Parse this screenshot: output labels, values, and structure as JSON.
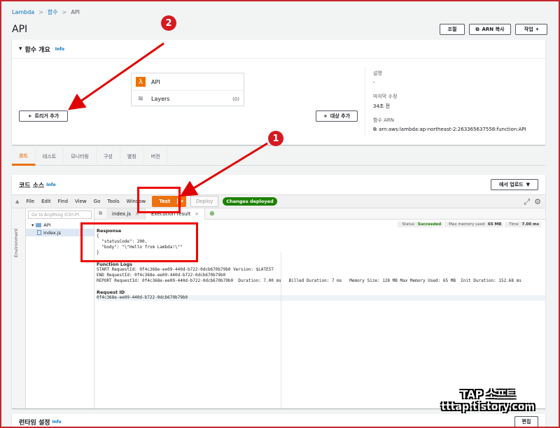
{
  "breadcrumb": {
    "root": "Lambda",
    "level2": "함수",
    "current": "API"
  },
  "title": "API",
  "header_buttons": {
    "throttle": "조절",
    "copy_arn": "ARN 복사",
    "actions": "작업"
  },
  "overview": {
    "heading": "함수 개요",
    "info": "Info",
    "function_name": "API",
    "layers_label": "Layers",
    "layers_count": "(0)",
    "add_trigger": "트리거 추가",
    "add_destination": "대상 추가",
    "description_label": "설명",
    "description_value": "-",
    "last_modified_label": "마지막 수정",
    "last_modified_value": "34초 전",
    "arn_label": "함수 ARN",
    "arn_value": "arn:aws:lambda:ap-northeast-2:263365637558:function:API"
  },
  "tabs": [
    "코드",
    "테스트",
    "모니터링",
    "구성",
    "별칭",
    "버전"
  ],
  "code_source": {
    "heading": "코드 소스",
    "info": "Info",
    "upload": "에서 업로드",
    "menu": [
      "File",
      "Edit",
      "Find",
      "View",
      "Go",
      "Tools",
      "Window"
    ],
    "test": "Test",
    "deploy": "Deploy",
    "deployed": "Changes deployed",
    "goto_placeholder": "Go to Anything (Ctrl-P)",
    "env_label": "Environment",
    "folder": "API",
    "file": "index.js",
    "tab_file": "index.js",
    "tab_result": "Execution result",
    "status_label": "Status",
    "status_value": "Succeeded",
    "memory_label": "Max memory used",
    "memory_value": "65 MB",
    "time_label": "Time",
    "time_value": "7.00 ms"
  },
  "result": {
    "response_heading": "Response",
    "response_lines": [
      "{",
      "  \"statusCode\": 200,",
      "  \"body\": \"\\\"Hello from Lambda!\\\"\"",
      "}"
    ],
    "logs_heading": "Function Logs",
    "log_lines": [
      "START RequestId: 0f4c368e-ee09-440d-b722-0dcb670b79b0 Version: $LATEST",
      "END RequestId: 0f4c368e-ee09-440d-b722-0dcb670b79b0",
      "REPORT RequestId: 0f4c368e-ee09-440d-b722-0dcb670b79b0  Duration: 7.00 ms   Billed Duration: 7 ms   Memory Size: 128 MB Max Memory Used: 65 MB  Init Duration: 152.68 ms"
    ],
    "request_heading": "Request ID",
    "request_id": "0f4c368e-ee09-440d-b722-0dcb670b79b0"
  },
  "runtime": {
    "heading": "런타임 설정",
    "info": "Info",
    "edit": "편집"
  },
  "annotations": {
    "badge1": "1",
    "badge2": "2"
  },
  "watermark": {
    "line1": "TAP 소프트",
    "line2": "tttap.tistory.com"
  },
  "colors": {
    "accent": "#ec7211",
    "link": "#0073bb",
    "annotation": "#e00000",
    "success": "#1d8102"
  }
}
